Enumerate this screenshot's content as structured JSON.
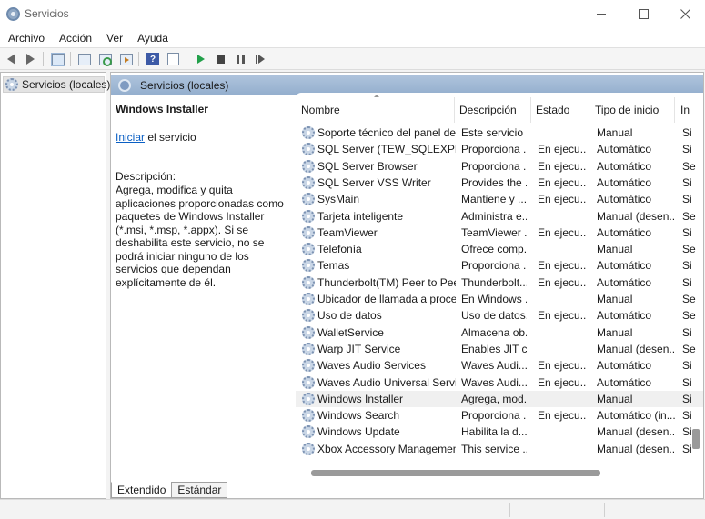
{
  "window": {
    "title": "Servicios"
  },
  "menu": [
    "Archivo",
    "Acción",
    "Ver",
    "Ayuda"
  ],
  "toolbar": {
    "icons": [
      "back-arrow-icon",
      "forward-arrow-icon",
      "show-tree-icon",
      "properties-icon",
      "refresh-icon",
      "export-list-icon",
      "help-icon",
      "console-icon",
      "start-service-icon",
      "stop-service-icon",
      "pause-service-icon",
      "restart-service-icon"
    ]
  },
  "tree": {
    "root_label": "Servicios (locales)"
  },
  "main": {
    "header_title": "Servicios (locales)",
    "selected_service": "Windows Installer",
    "start_link": "Iniciar",
    "start_suffix": " el servicio",
    "desc_label": "Descripción:",
    "desc_text": "Agrega, modifica y quita aplicaciones proporcionadas como paquetes de Windows Installer (*.msi, *.msp, *.appx). Si se deshabilita este servicio, no se podrá iniciar ninguno de los servicios que dependan explícitamente de él."
  },
  "columns": [
    "Nombre",
    "Descripción",
    "Estado",
    "Tipo de inicio",
    "In"
  ],
  "rows": [
    {
      "name": "Soporte técnico del panel de...",
      "desc": "Este servicio ...",
      "state": "",
      "start": "Manual",
      "i": "Si"
    },
    {
      "name": "SQL Server (TEW_SQLEXPRESS)",
      "desc": "Proporciona ...",
      "state": "En ejecu...",
      "start": "Automático",
      "i": "Si"
    },
    {
      "name": "SQL Server Browser",
      "desc": "Proporciona ...",
      "state": "En ejecu...",
      "start": "Automático",
      "i": "Se"
    },
    {
      "name": "SQL Server VSS Writer",
      "desc": "Provides the ...",
      "state": "En ejecu...",
      "start": "Automático",
      "i": "Si"
    },
    {
      "name": "SysMain",
      "desc": "Mantiene y ...",
      "state": "En ejecu...",
      "start": "Automático",
      "i": "Si"
    },
    {
      "name": "Tarjeta inteligente",
      "desc": "Administra e...",
      "state": "",
      "start": "Manual (desen...",
      "i": "Se"
    },
    {
      "name": "TeamViewer",
      "desc": "TeamViewer ...",
      "state": "En ejecu...",
      "start": "Automático",
      "i": "Si"
    },
    {
      "name": "Telefonía",
      "desc": "Ofrece comp...",
      "state": "",
      "start": "Manual",
      "i": "Se"
    },
    {
      "name": "Temas",
      "desc": "Proporciona ...",
      "state": "En ejecu...",
      "start": "Automático",
      "i": "Si"
    },
    {
      "name": "Thunderbolt(TM) Peer to Pee...",
      "desc": "Thunderbolt...",
      "state": "En ejecu...",
      "start": "Automático",
      "i": "Si"
    },
    {
      "name": "Ubicador de llamada a proce...",
      "desc": "En Windows ...",
      "state": "",
      "start": "Manual",
      "i": "Se"
    },
    {
      "name": "Uso de datos",
      "desc": "Uso de datos...",
      "state": "En ejecu...",
      "start": "Automático",
      "i": "Se"
    },
    {
      "name": "WalletService",
      "desc": "Almacena ob...",
      "state": "",
      "start": "Manual",
      "i": "Si"
    },
    {
      "name": "Warp JIT Service",
      "desc": "Enables JIT c...",
      "state": "",
      "start": "Manual (desen...",
      "i": "Se"
    },
    {
      "name": "Waves Audio Services",
      "desc": "Waves Audi...",
      "state": "En ejecu...",
      "start": "Automático",
      "i": "Si"
    },
    {
      "name": "Waves Audio Universal Servi...",
      "desc": "Waves Audi...",
      "state": "En ejecu...",
      "start": "Automático",
      "i": "Si"
    },
    {
      "name": "Windows Installer",
      "desc": "Agrega, mod...",
      "state": "",
      "start": "Manual",
      "i": "Si",
      "selected": true
    },
    {
      "name": "Windows Search",
      "desc": "Proporciona ...",
      "state": "En ejecu...",
      "start": "Automático (in...",
      "i": "Si"
    },
    {
      "name": "Windows Update",
      "desc": "Habilita la d...",
      "state": "",
      "start": "Manual (desen...",
      "i": "Si"
    },
    {
      "name": "Xbox Accessory Managemen...",
      "desc": "This service ...",
      "state": "",
      "start": "Manual (desen...",
      "i": "Si"
    }
  ],
  "tabs": [
    "Extendido",
    "Estándar"
  ]
}
